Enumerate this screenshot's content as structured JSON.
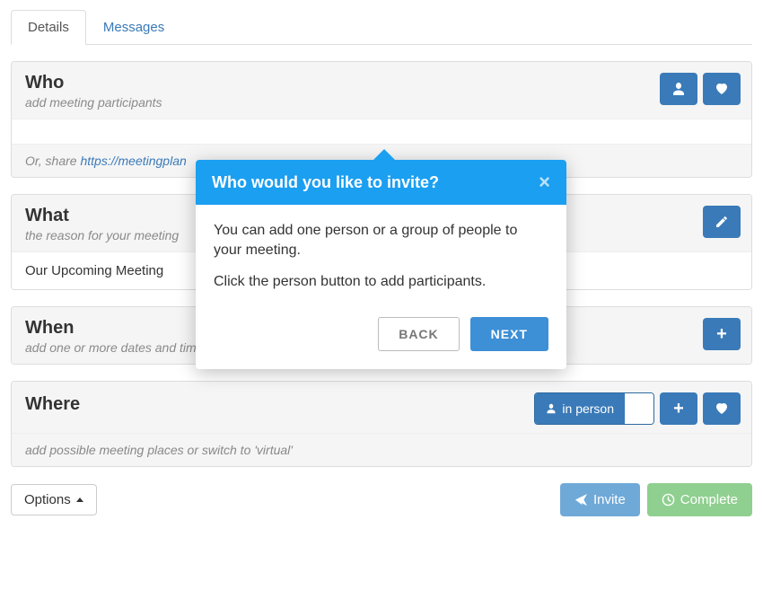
{
  "tabs": {
    "details": "Details",
    "messages": "Messages"
  },
  "who": {
    "title": "Who",
    "subtitle": "add meeting participants",
    "share_prefix": "Or, share ",
    "share_link": "https://meetingplan"
  },
  "what": {
    "title": "What",
    "subtitle": "the reason for your meeting",
    "value": "Our Upcoming Meeting"
  },
  "when": {
    "title": "When",
    "subtitle": "add one or more dates and times for participants to choose from"
  },
  "where": {
    "title": "Where",
    "in_person_label": "in person",
    "subtitle": "add possible meeting places or switch to 'virtual'"
  },
  "bottom": {
    "options": "Options",
    "invite": "Invite",
    "complete": "Complete"
  },
  "popover": {
    "title": "Who would you like to invite?",
    "p1": "You can add one person or a group of people to your meeting.",
    "p2": "Click the person button to add participants.",
    "back": "BACK",
    "next": "NEXT"
  }
}
